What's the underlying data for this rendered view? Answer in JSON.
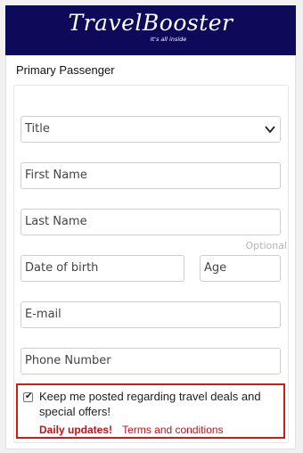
{
  "brand": {
    "name": "TravelBooster",
    "tagline": "It's all inside",
    "bar_color": "#0d0a5a"
  },
  "section": {
    "title": "Primary Passenger"
  },
  "form": {
    "title": {
      "value": "Title",
      "caret": "chevron-down-icon"
    },
    "first_name": {
      "placeholder": "First Name"
    },
    "last_name": {
      "placeholder": "Last Name"
    },
    "optional_label": "Optional",
    "dob": {
      "placeholder": "Date of birth"
    },
    "age": {
      "placeholder": "Age"
    },
    "email": {
      "placeholder": "E-mail"
    },
    "phone": {
      "placeholder": "Phone Number"
    }
  },
  "consent": {
    "checked": true,
    "text": "Keep me posted regarding travel deals and special offers!",
    "daily": "Daily updates!",
    "terms": "Terms and conditions",
    "highlight_color": "#d01b1b"
  }
}
